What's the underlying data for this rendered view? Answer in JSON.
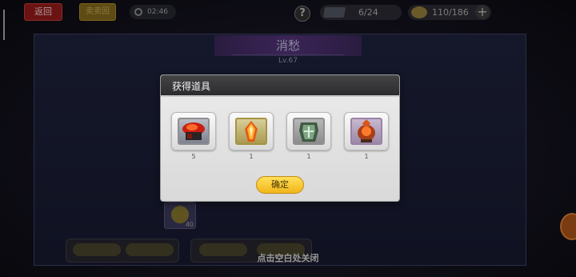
{
  "topbar": {
    "back_label": "返回",
    "yellow_label": "卖卖回",
    "timer": "02:46",
    "help_label": "?",
    "resource1": "6/24",
    "resource2": "110/186",
    "plus_label": "+"
  },
  "scene": {
    "hero_name": "消愁",
    "hero_level": "Lv.67",
    "ghost_count": "40",
    "hint": "点击空白处关闭"
  },
  "modal": {
    "title": "获得道具",
    "items": [
      {
        "icon": "red-crystal-box-icon",
        "qty": "5"
      },
      {
        "icon": "fire-crystal-icon",
        "qty": "1"
      },
      {
        "icon": "jade-armor-box-icon",
        "qty": "1"
      },
      {
        "icon": "flame-urn-icon",
        "qty": "1"
      }
    ],
    "confirm_label": "确定"
  },
  "colors": {
    "modal_header": "#2b2b2e",
    "confirm": "#f2b51a",
    "back_button": "#6b1313"
  }
}
